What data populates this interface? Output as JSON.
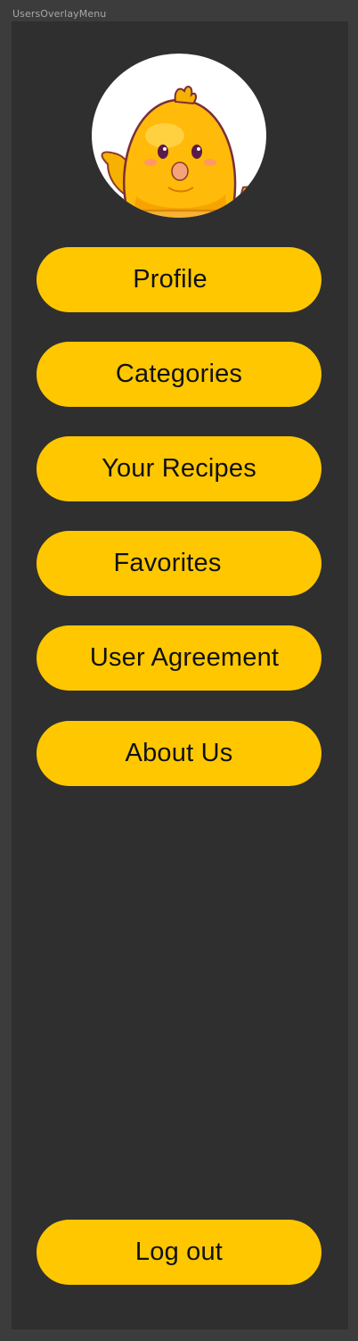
{
  "frame": {
    "label": "UsersOverlayMenu"
  },
  "avatar": {
    "icon": "chick-mascot-icon"
  },
  "menu": {
    "profile": "Profile",
    "categories": "Categories",
    "your_recipes": "Your Recipes",
    "favorites": "Favorites",
    "user_agreement": "User Agreement",
    "about_us": "About Us"
  },
  "footer": {
    "logout": "Log out"
  },
  "colors": {
    "button": "#ffc700",
    "panel": "#2f2f2f",
    "background": "#3c3c3c"
  }
}
